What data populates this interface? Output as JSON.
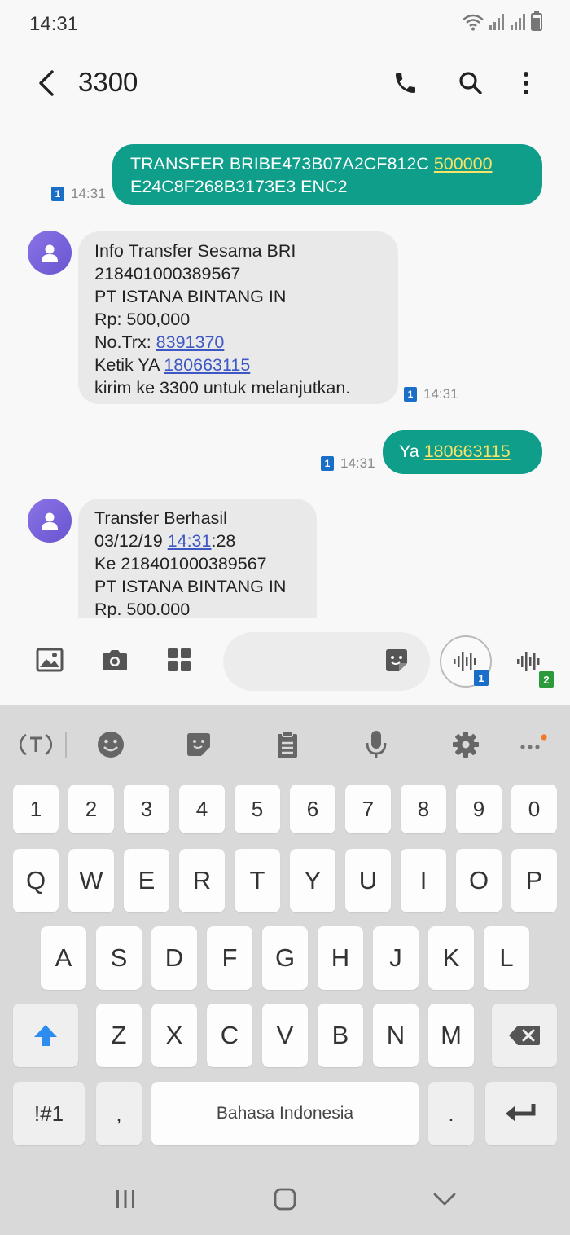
{
  "status_bar": {
    "time": "14:31"
  },
  "app_bar": {
    "title": "3300"
  },
  "messages": [
    {
      "direction": "out",
      "lines": [
        {
          "parts": [
            {
              "text": "TRANSFER BRIBE473B07A2CF812C "
            },
            {
              "text": "500000",
              "link": true
            }
          ]
        },
        {
          "parts": [
            {
              "text": "E24C8F268B3173E3 ENC2"
            }
          ]
        }
      ],
      "sim": "1",
      "time": "14:31"
    },
    {
      "direction": "in",
      "lines": [
        {
          "parts": [
            {
              "text": "Info Transfer Sesama BRI"
            }
          ]
        },
        {
          "parts": [
            {
              "text": "218401000389567"
            }
          ]
        },
        {
          "parts": [
            {
              "text": "PT ISTANA BINTANG IN"
            }
          ]
        },
        {
          "parts": [
            {
              "text": "Rp: 500,000"
            }
          ]
        },
        {
          "parts": [
            {
              "text": "No.Trx: "
            },
            {
              "text": "8391370",
              "link": true
            }
          ]
        },
        {
          "parts": [
            {
              "text": "Ketik YA "
            },
            {
              "text": "180663115",
              "link": true
            }
          ]
        },
        {
          "parts": [
            {
              "text": "kirim ke 3300 untuk melanjutkan."
            }
          ]
        }
      ],
      "sim": "1",
      "time": "14:31"
    },
    {
      "direction": "out",
      "lines": [
        {
          "parts": [
            {
              "text": "Ya "
            },
            {
              "text": "180663115",
              "link": true
            }
          ]
        }
      ],
      "sim": "1",
      "time": "14:31"
    },
    {
      "direction": "in",
      "lines": [
        {
          "parts": [
            {
              "text": "Transfer Berhasil"
            }
          ]
        },
        {
          "parts": [
            {
              "text": "03/12/19 "
            },
            {
              "text": "14:31",
              "link": true
            },
            {
              "text": ":28"
            }
          ]
        },
        {
          "parts": [
            {
              "text": "Ke 218401000389567"
            }
          ]
        },
        {
          "parts": [
            {
              "text": "PT ISTANA BINTANG IN"
            }
          ]
        },
        {
          "parts": [
            {
              "text": "Rp. 500.000"
            }
          ]
        }
      ]
    }
  ],
  "compose": {
    "input_value": "",
    "voice_sim_1": "1",
    "voice_sim_2": "2"
  },
  "keyboard": {
    "row_numbers": [
      "1",
      "2",
      "3",
      "4",
      "5",
      "6",
      "7",
      "8",
      "9",
      "0"
    ],
    "row_qwerty": [
      "Q",
      "W",
      "E",
      "R",
      "T",
      "Y",
      "U",
      "I",
      "O",
      "P"
    ],
    "row_asdf": [
      "A",
      "S",
      "D",
      "F",
      "G",
      "H",
      "J",
      "K",
      "L"
    ],
    "row_zxcv": [
      "Z",
      "X",
      "C",
      "V",
      "B",
      "N",
      "M"
    ],
    "symbols_key": "!#1",
    "comma_key": ",",
    "space_label": "Bahasa Indonesia",
    "period_key": "."
  },
  "colors": {
    "outgoing_bubble": "#0e9e8a",
    "incoming_bubble": "#e9e9e9",
    "avatar": "#7a64dc",
    "sim_badge": "#1b6ec8",
    "sim2_badge": "#2a9a3a",
    "keyboard_bg": "#d9d9d9"
  },
  "icons": {
    "status": [
      "wifi-icon",
      "signal-icon",
      "signal-icon",
      "battery-icon"
    ],
    "app_bar": [
      "back-arrow-icon",
      "phone-icon",
      "search-icon",
      "more-vert-icon"
    ],
    "compose": [
      "image-icon",
      "camera-icon",
      "apps-icon",
      "sticker-icon",
      "voice-message-icon"
    ],
    "keyboard_toolbar": [
      "text-recognition-icon",
      "emoji-icon",
      "sticker-icon",
      "clipboard-icon",
      "mic-icon",
      "settings-icon",
      "more-horiz-icon"
    ],
    "keyboard_keys": [
      "shift-icon",
      "backspace-icon",
      "enter-icon"
    ],
    "nav": [
      "recents-icon",
      "home-icon",
      "back-chevron-icon"
    ]
  }
}
